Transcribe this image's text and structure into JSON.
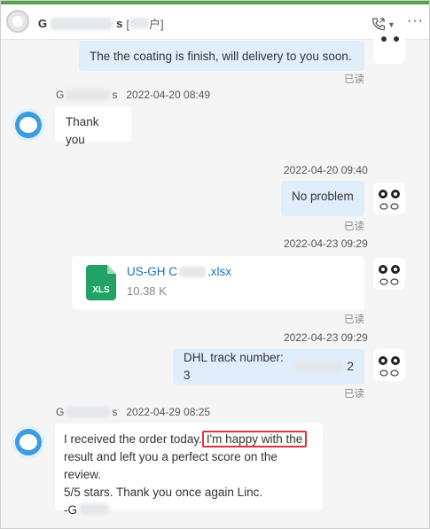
{
  "header": {
    "title_prefix": "G",
    "title_suffix": "s",
    "subtitle_open": "[",
    "subtitle_mid": "户]"
  },
  "messages": {
    "m1": {
      "text": "The the coating is finish, will delivery to you soon.",
      "status": "已读"
    },
    "m2": {
      "sender_prefix": "G",
      "sender_suffix": "s",
      "time": "2022-04-20 08:49",
      "text": "Thank you"
    },
    "m3": {
      "time": "2022-04-20 09:40",
      "text": "No problem",
      "status": "已读"
    },
    "m4": {
      "time": "2022-04-23 09:29",
      "file_name_prefix": "US-GH C",
      "file_name_suffix": ".xlsx",
      "file_size": "10.38 K",
      "file_type": "XLS",
      "status": "已读"
    },
    "m5": {
      "time": "2022-04-23 09:29",
      "text_prefix": "DHL track number: 3",
      "text_suffix": "2",
      "status": "已读"
    },
    "m6": {
      "sender_prefix": "G",
      "sender_suffix": "s",
      "time": "2022-04-29 08:25",
      "line1_start": "I received the order today.",
      "line1_highlight": "I'm happy with the",
      "line2": "result and left you a perfect score on the review.",
      "line3": "5/5 stars. Thank you once again Linc.",
      "line4": "-G"
    }
  },
  "icons": [
    "phone-call-icon",
    "chevron-down-icon",
    "more-icon",
    "xls-file-icon"
  ],
  "colors": {
    "accent": "#56a34a",
    "bubble_right": "#e0eefb",
    "link": "#1f6fb7",
    "highlight": "#d9363e"
  }
}
